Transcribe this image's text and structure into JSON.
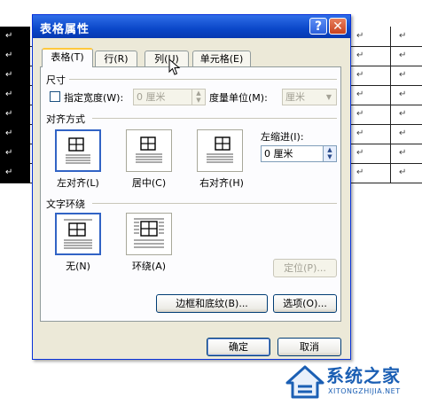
{
  "doc": {
    "row_count": 8,
    "mark_glyph": "↵"
  },
  "dialog": {
    "title": "表格属性",
    "help_glyph": "?",
    "close_glyph": "✕",
    "tabs": [
      {
        "label": "表格(T)",
        "active": true
      },
      {
        "label": "行(R)",
        "active": false
      },
      {
        "label": "列(U)",
        "active": false
      },
      {
        "label": "单元格(E)",
        "active": false
      }
    ],
    "size": {
      "section": "尺寸",
      "specify_width_label": "指定宽度(W):",
      "width_value": "0 厘米",
      "unit_label": "度量单位(M):",
      "unit_value": "厘米"
    },
    "alignment": {
      "section": "对齐方式",
      "options": [
        "左对齐(L)",
        "居中(C)",
        "右对齐(H)"
      ],
      "selected": "左对齐(L)",
      "indent_label": "左缩进(I):",
      "indent_value": "0 厘米"
    },
    "wrap": {
      "section": "文字环绕",
      "options": [
        "无(N)",
        "环绕(A)"
      ],
      "selected": "无(N)"
    },
    "positioning_button": "定位(P)...",
    "borders_button": "边框和底纹(B)...",
    "options_button": "选项(O)...",
    "ok_button": "确定",
    "cancel_button": "取消"
  },
  "watermark": {
    "cn": "系统之家",
    "en": "XITONGZHIJIA.NET"
  },
  "colors": {
    "titlebar": "#0a47c9",
    "dialog_bg": "#ece9d8",
    "selected_border": "#3163c5",
    "watermark": "#1b5fb4"
  }
}
